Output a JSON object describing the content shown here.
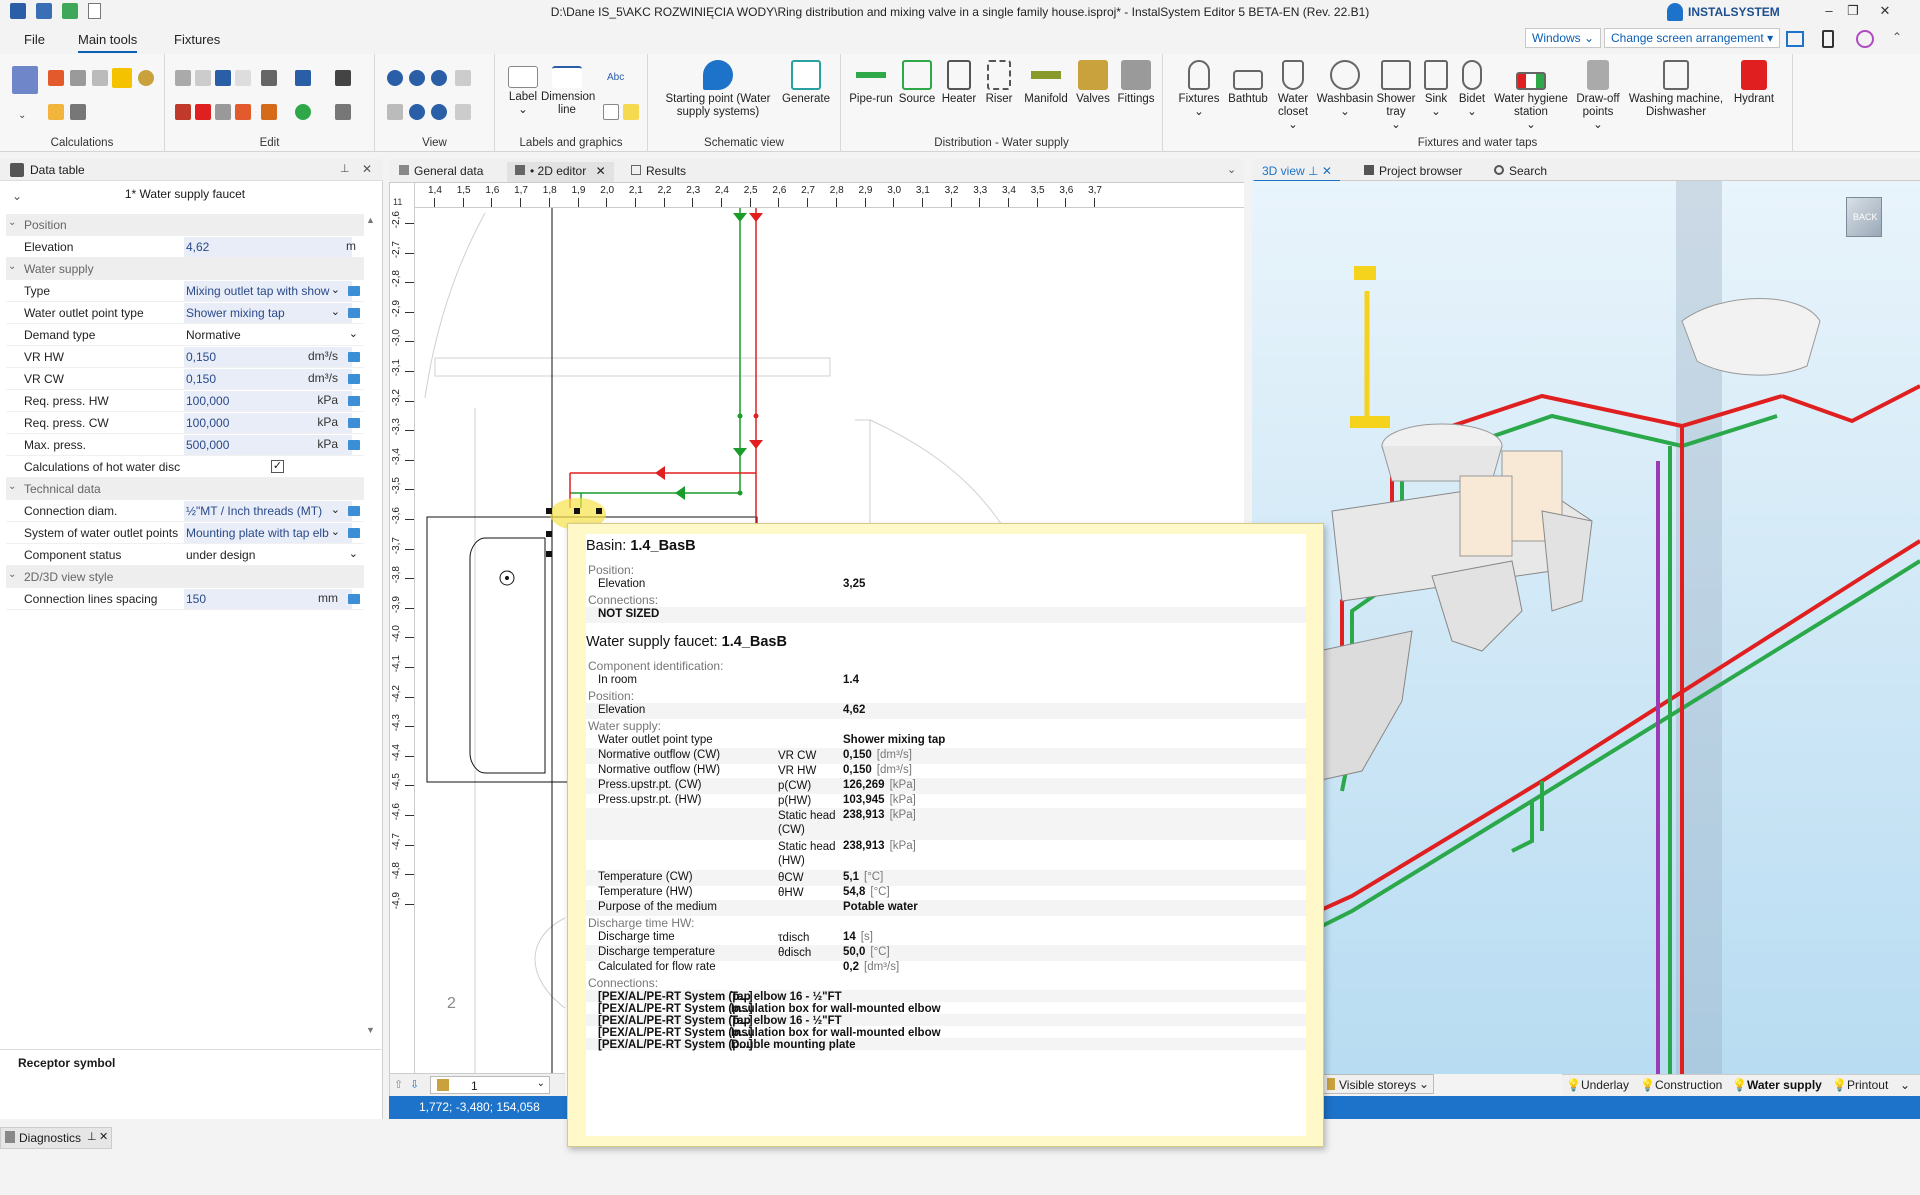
{
  "window": {
    "title": "D:\\Dane IS_5\\AKC ROZWINIĘCIA WODY\\Ring distribution and mixing valve in a single family house.isproj* - InstalSystem Editor 5 BETA-EN (Rev. 22.B1)",
    "brand": "INSTALSYSTEM"
  },
  "menu": {
    "tabs": [
      "File",
      "Main tools",
      "Fixtures"
    ],
    "windows_btn": "Windows",
    "arrangement_btn": "Change screen arrangement"
  },
  "ribbon": {
    "groups": {
      "calculations": "Calculations",
      "edit": "Edit",
      "view": "View",
      "labels": "Labels and graphics",
      "schematic": "Schematic view",
      "distribution": "Distribution - Water supply",
      "fixtures": "Fixtures and water taps"
    },
    "buttons": {
      "label": "Label",
      "dimension": "Dimension line",
      "starting_point": "Starting point (Water supply systems)",
      "generate": "Generate",
      "pipe_run": "Pipe-run",
      "source": "Source",
      "heater": "Heater",
      "riser": "Riser",
      "manifold": "Manifold",
      "valves": "Valves",
      "fittings": "Fittings",
      "fixtures": "Fixtures",
      "bathtub": "Bathtub",
      "water_closet": "Water closet",
      "washbasin": "Washbasin",
      "shower_tray": "Shower tray",
      "sink": "Sink",
      "bidet": "Bidet",
      "hygiene_station": "Water hygiene station",
      "drawoff": "Draw-off points",
      "washing": "Washing machine, Dishwasher",
      "hydrant": "Hydrant",
      "abc": "Abc"
    }
  },
  "left_panel": {
    "title": "Data table",
    "component": "1* Water supply faucet",
    "rows": [
      {
        "kind": "cat",
        "label": "Position"
      },
      {
        "kind": "row",
        "label": "Elevation",
        "value": "4,62",
        "unit": "m",
        "shaded": true
      },
      {
        "kind": "cat",
        "label": "Water supply"
      },
      {
        "kind": "row",
        "label": "Type",
        "value": "Mixing outlet tap with show",
        "unit": "",
        "shaded": true,
        "dropdown": true,
        "edit": true
      },
      {
        "kind": "row",
        "label": "Water outlet point type",
        "value": "Shower mixing tap",
        "unit": "",
        "shaded": true,
        "dropdown": true,
        "edit": true
      },
      {
        "kind": "row",
        "label": "Demand type",
        "value": "Normative",
        "unit": "",
        "shaded": false,
        "dropdown": true
      },
      {
        "kind": "row",
        "label": "VR HW",
        "value": "0,150",
        "unit": "dm³/s",
        "shaded": true,
        "edit": true
      },
      {
        "kind": "row",
        "label": "VR CW",
        "value": "0,150",
        "unit": "dm³/s",
        "shaded": true,
        "edit": true
      },
      {
        "kind": "row",
        "label": "Req. press. HW",
        "value": "100,000",
        "unit": "kPa",
        "shaded": true,
        "edit": true
      },
      {
        "kind": "row",
        "label": "Req. press. CW",
        "value": "100,000",
        "unit": "kPa",
        "shaded": true,
        "edit": true
      },
      {
        "kind": "row",
        "label": "Max. press.",
        "value": "500,000",
        "unit": "kPa",
        "shaded": true,
        "edit": true
      },
      {
        "kind": "row",
        "label": "Calculations of hot water disc",
        "value": "",
        "unit": "",
        "shaded": false,
        "check": true
      },
      {
        "kind": "cat",
        "label": "Technical data"
      },
      {
        "kind": "row",
        "label": "Connection diam.",
        "value": "½\"MT / Inch threads (MT)",
        "unit": "",
        "shaded": true,
        "dropdown": true,
        "edit": true
      },
      {
        "kind": "row",
        "label": "System of water outlet points",
        "value": "Mounting plate with tap elb",
        "unit": "",
        "shaded": true,
        "dropdown": true,
        "edit": true
      },
      {
        "kind": "row",
        "label": "Component status",
        "value": "under design",
        "unit": "",
        "shaded": false,
        "dropdown": true
      },
      {
        "kind": "cat",
        "label": "2D/3D view style"
      },
      {
        "kind": "row",
        "label": "Connection lines spacing",
        "value": "150",
        "unit": "mm",
        "shaded": true,
        "edit": true
      }
    ],
    "receptor": "Receptor symbol"
  },
  "editor": {
    "tabs": [
      "General data",
      "• 2D editor",
      "Results"
    ],
    "ruler_x": [
      "1,4",
      "1,5",
      "1,6",
      "1,7",
      "1,8",
      "1,9",
      "2,0",
      "2,1",
      "2,2",
      "2,3",
      "2,4",
      "2,5",
      "2,6",
      "2,7",
      "2,8",
      "2,9",
      "3,0",
      "3,1",
      "3,2",
      "3,3",
      "3,4",
      "3,5",
      "3,6",
      "3,7"
    ],
    "ruler_y": [
      "-2,6",
      "-2,7",
      "-2,8",
      "-2,9",
      "-3,0",
      "-3,1",
      "-3,2",
      "-3,3",
      "-3,4",
      "-3,5",
      "-3,6",
      "-3,7",
      "-3,8",
      "-3,9",
      "-4,0",
      "-4,1",
      "-4,2",
      "-4,3",
      "-4,4",
      "-4,5",
      "-4,6",
      "-4,7",
      "-4,8",
      "-4,9"
    ],
    "ruler_corner": "11",
    "storey": "1",
    "coords": "1,772; -3,480; 154,058",
    "drawing_numbers": [
      "2"
    ]
  },
  "view3d": {
    "tabs": [
      "3D view",
      "Project browser",
      "Search"
    ],
    "cube": "BACK",
    "visible_storeys": "Visible storeys",
    "bottom_tabs": [
      "Underlay",
      "Construction",
      "Water supply",
      "Printout"
    ]
  },
  "popup": {
    "basin_title_prefix": "Basin: ",
    "basin_title": "1.4_BasB",
    "basin_rows": [
      {
        "type": "cat",
        "label": "Position:"
      },
      {
        "type": "row",
        "label": "Elevation",
        "sym": "",
        "value": "3,25",
        "unit": ""
      },
      {
        "type": "cat",
        "label": "Connections:"
      },
      {
        "type": "row",
        "label": "NOT SIZED",
        "sym": "",
        "value": "",
        "unit": "",
        "bold": true
      }
    ],
    "faucet_title_prefix": "Water supply faucet: ",
    "faucet_title": "1.4_BasB",
    "faucet_rows": [
      {
        "type": "cat",
        "label": "Component identification:"
      },
      {
        "type": "row",
        "label": "In room",
        "sym": "",
        "value": "1.4",
        "unit": ""
      },
      {
        "type": "cat",
        "label": "Position:"
      },
      {
        "type": "row",
        "label": "Elevation",
        "sym": "",
        "value": "4,62",
        "unit": ""
      },
      {
        "type": "cat",
        "label": "Water supply:"
      },
      {
        "type": "row",
        "label": "Water outlet point type",
        "sym": "",
        "value": "Shower mixing tap",
        "unit": ""
      },
      {
        "type": "row",
        "label": "Normative outflow (CW)",
        "sym": "VR CW",
        "value": "0,150",
        "unit": "[dm³/s]"
      },
      {
        "type": "row",
        "label": "Normative outflow (HW)",
        "sym": "VR HW",
        "value": "0,150",
        "unit": "[dm³/s]"
      },
      {
        "type": "row",
        "label": "Press.upstr.pt. (CW)",
        "sym": "p(CW)",
        "value": "126,269",
        "unit": "[kPa]"
      },
      {
        "type": "row",
        "label": "Press.upstr.pt. (HW)",
        "sym": "p(HW)",
        "value": "103,945",
        "unit": "[kPa]"
      },
      {
        "type": "row2",
        "label": "",
        "sym": "Static head (CW)",
        "value": "238,913",
        "unit": "[kPa]"
      },
      {
        "type": "row2",
        "label": "",
        "sym": "Static head (HW)",
        "value": "238,913",
        "unit": "[kPa]"
      },
      {
        "type": "row",
        "label": "Temperature (CW)",
        "sym": "θCW",
        "value": "5,1",
        "unit": "[°C]"
      },
      {
        "type": "row",
        "label": "Temperature (HW)",
        "sym": "θHW",
        "value": "54,8",
        "unit": "[°C]"
      },
      {
        "type": "row",
        "label": "Purpose of the medium",
        "sym": "",
        "value": "Potable water",
        "unit": ""
      },
      {
        "type": "cat",
        "label": "Discharge time HW:"
      },
      {
        "type": "row",
        "label": "Discharge time",
        "sym": "τdisch",
        "value": "14",
        "unit": "[s]"
      },
      {
        "type": "row",
        "label": "Discharge temperature",
        "sym": "θdisch",
        "value": "50,0",
        "unit": "[°C]"
      },
      {
        "type": "row",
        "label": "Calculated for flow rate",
        "sym": "",
        "value": "0,2",
        "unit": "[dm³/s]"
      },
      {
        "type": "cat",
        "label": "Connections:"
      },
      {
        "type": "conn",
        "label": "[PEX/AL/PE-RT System (p...]",
        "value": "Tap elbow 16 - ½\"FT"
      },
      {
        "type": "conn",
        "label": "[PEX/AL/PE-RT System (p...]",
        "value": "Insulation box for wall-mounted elbow"
      },
      {
        "type": "conn",
        "label": "[PEX/AL/PE-RT System (p...]",
        "value": "Tap elbow 16 - ½\"FT"
      },
      {
        "type": "conn",
        "label": "[PEX/AL/PE-RT System (p...]",
        "value": "Insulation box for wall-mounted elbow"
      },
      {
        "type": "conn",
        "label": "[PEX/AL/PE-RT System (p...]",
        "value": "Double mounting plate"
      }
    ]
  },
  "diagnostics": "Diagnostics",
  "colors": {
    "accent": "#1d73c9",
    "cold": "#1a9c2a",
    "hot": "#e02020",
    "popup_bg": "#fff8c9"
  }
}
